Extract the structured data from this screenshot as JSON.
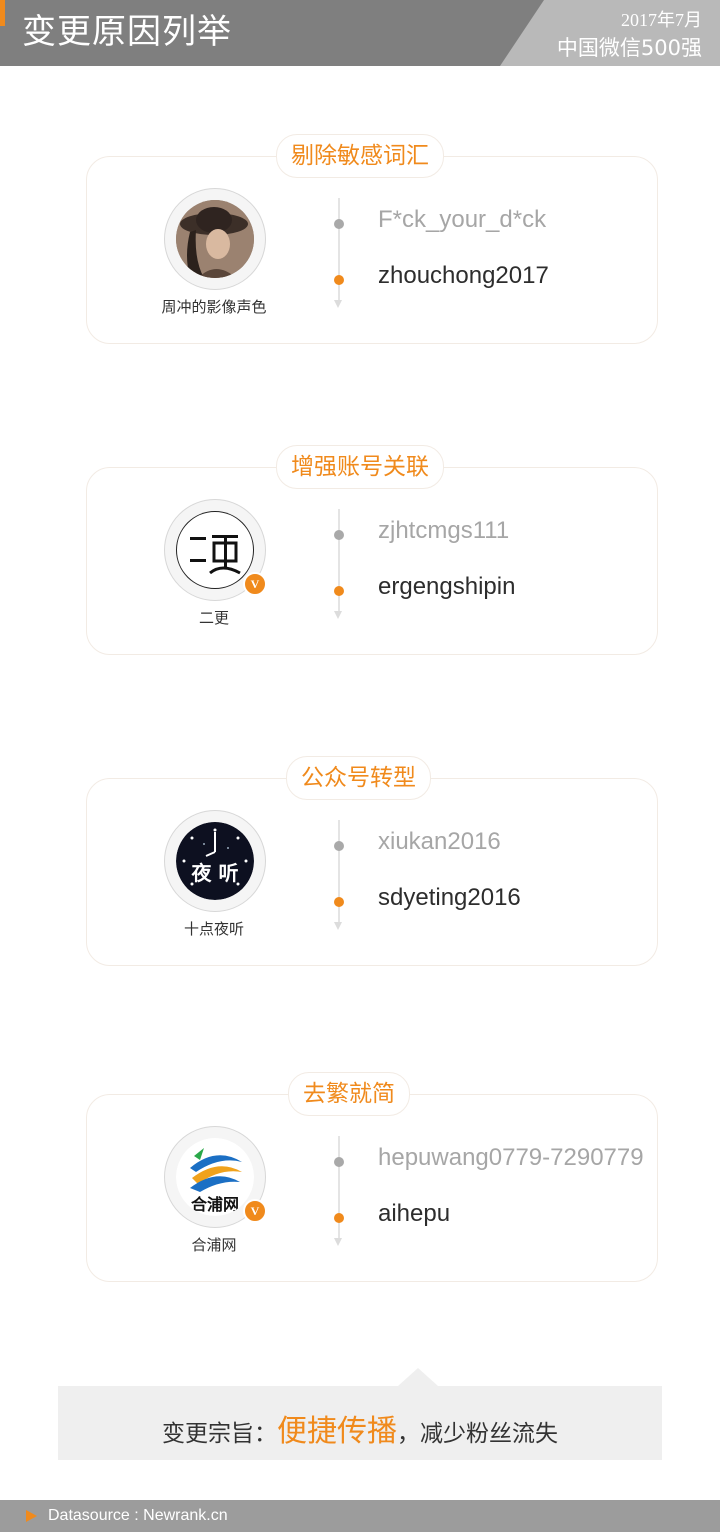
{
  "header": {
    "title": "变更原因列举",
    "date": "2017年7月",
    "subtitle": "中国微信500强"
  },
  "sections": [
    {
      "tag": "剔除敏感词汇",
      "account_name": "周冲的影像声色",
      "old_id": "F*ck_your_d*ck",
      "new_id": "zhouchong2017",
      "avatar_icon": "woman-portrait-avatar",
      "verified": false
    },
    {
      "tag": "增强账号关联",
      "account_name": "二更",
      "old_id": "zjhtcmgs111",
      "new_id": "ergengshipin",
      "avatar_icon": "ergeng-logo-avatar",
      "verified": true
    },
    {
      "tag": "公众号转型",
      "account_name": "十点夜听",
      "old_id": "xiukan2016",
      "new_id": "sdyeting2016",
      "avatar_icon": "clock-night-avatar",
      "avatar_text": "夜 听",
      "verified": false
    },
    {
      "tag": "去繁就简",
      "account_name": "合浦网",
      "old_id": "hepuwang0779-7290779",
      "new_id": "aihepu",
      "avatar_icon": "hepu-logo-avatar",
      "avatar_text": "合浦网",
      "verified": true
    }
  ],
  "badge_label": "V",
  "summary": {
    "prefix": "变更宗旨：",
    "highlight": "便捷传播",
    "suffix": "，减少粉丝流失"
  },
  "footer": {
    "text": "Datasource : Newrank.cn"
  },
  "colors": {
    "accent": "#f08a1c",
    "header_bg": "#7f7f7f",
    "footer_bg": "#9c9c9c"
  }
}
